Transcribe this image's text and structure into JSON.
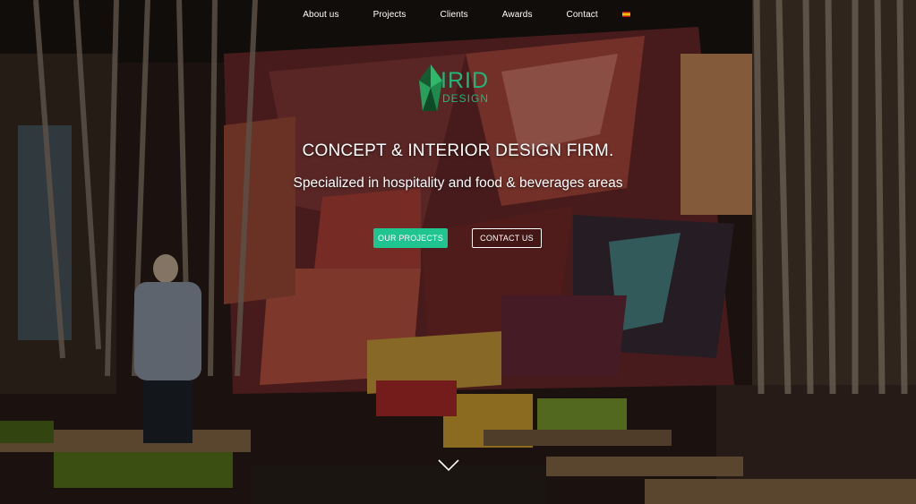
{
  "nav": {
    "items": [
      "About us",
      "Projects",
      "Clients",
      "Awards",
      "Contact"
    ],
    "language_icon": "spain-flag-icon"
  },
  "logo": {
    "main": "IRID",
    "sub": "DESIGN",
    "color": "#21b67a"
  },
  "hero": {
    "headline": "CONCEPT & INTERIOR DESIGN FIRM.",
    "subline": "Specialized in hospitality and food & beverages areas"
  },
  "buttons": {
    "projects": "OUR PROJECTS",
    "contact": "CONTACT US"
  },
  "colors": {
    "accent": "#1fc48f"
  },
  "scroll_icon": "chevron-down-icon"
}
